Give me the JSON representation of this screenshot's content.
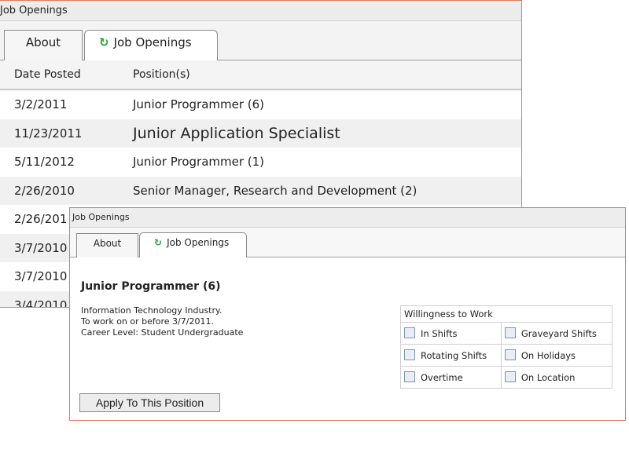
{
  "back_window": {
    "title": "Job Openings",
    "tabs": [
      {
        "label": "About"
      },
      {
        "label": "Job Openings",
        "icon": "refresh-icon"
      }
    ],
    "columns": [
      "Date Posted",
      "Position(s)"
    ],
    "rows": [
      {
        "date": "3/2/2011",
        "position": "Junior Programmer (6)"
      },
      {
        "date": "11/23/2011",
        "position": "Junior Application Specialist"
      },
      {
        "date": "5/11/2012",
        "position": "Junior Programmer (1)"
      },
      {
        "date": "2/26/2010",
        "position": "Senior Manager, Research and Development (2)"
      },
      {
        "date": "2/26/201",
        "position": ""
      },
      {
        "date": "3/7/2010",
        "position": ""
      },
      {
        "date": "3/7/2010",
        "position": ""
      },
      {
        "date": "3/4/2010",
        "position": ""
      }
    ]
  },
  "front_window": {
    "title": "Job Openings",
    "tabs": [
      {
        "label": "About"
      },
      {
        "label": "Job Openings",
        "icon": "refresh-icon"
      }
    ],
    "job_title": "Junior Programmer (6)",
    "details": [
      "Information Technology Industry.",
      "To work on or before 3/7/2011.",
      "Career Level: Student Undergraduate"
    ],
    "willingness": {
      "header": "Willingness to Work",
      "options": [
        [
          "In Shifts",
          "Graveyard Shifts"
        ],
        [
          "Rotating Shifts",
          "On Holidays"
        ],
        [
          "Overtime",
          "On Location"
        ]
      ]
    },
    "apply_label": "Apply To This Position"
  },
  "colors": {
    "window_border": "#e07a5f",
    "refresh_icon": "#2aa640"
  }
}
